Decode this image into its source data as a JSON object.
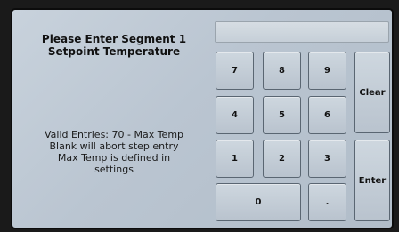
{
  "prompt": {
    "line1": "Please Enter Segment 1",
    "line2": "Setpoint Temperature"
  },
  "info": {
    "line1": "Valid Entries: 70 - Max Temp",
    "line2": "Blank will abort step entry",
    "line3": "Max Temp is defined in",
    "line4": "settings"
  },
  "display": {
    "value": ""
  },
  "keypad": {
    "k7": "7",
    "k8": "8",
    "k9": "9",
    "k4": "4",
    "k5": "5",
    "k6": "6",
    "k1": "1",
    "k2": "2",
    "k3": "3",
    "k0": "0",
    "dot": ".",
    "clear": "Clear",
    "enter": "Enter"
  }
}
